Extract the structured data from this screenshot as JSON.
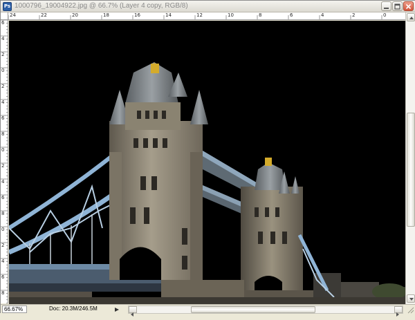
{
  "window": {
    "app_icon": "Ps",
    "title": "1000796_19004922.jpg @ 66.7% (Layer 4 copy, RGB/8)",
    "icons": {
      "app": "photoshop-icon",
      "minimize": "minimize-icon",
      "maximize": "maximize-icon",
      "close": "close-icon"
    }
  },
  "rulers": {
    "horizontal": [
      "24",
      "22",
      "20",
      "18",
      "16",
      "14",
      "12",
      "10",
      "8",
      "6",
      "4",
      "2",
      "0"
    ],
    "vertical": [
      "6",
      "4",
      "2",
      "0",
      "2",
      "4",
      "6",
      "8",
      "0",
      "2",
      "4",
      "6",
      "8",
      "0",
      "2",
      "4",
      "6",
      "8"
    ]
  },
  "canvas": {
    "background": "#000000",
    "image_subject": "tower-bridge-image"
  },
  "status": {
    "zoom": "66.67%",
    "doc_info": "Doc: 20.3M/246.5M"
  },
  "colors": {
    "chrome": "#ece9d8",
    "bridge_cable": "#8fb4d6",
    "stone": "#8d8677"
  }
}
